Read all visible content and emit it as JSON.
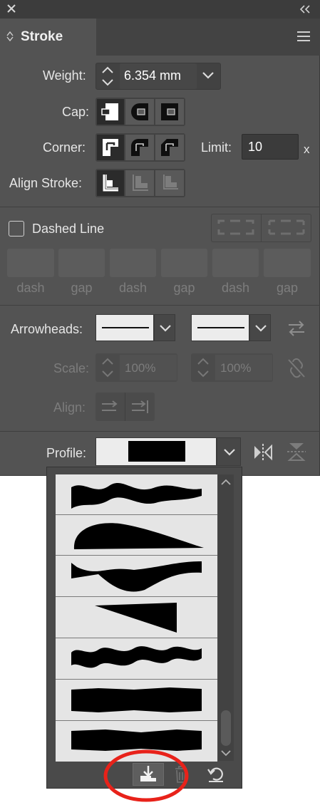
{
  "panel": {
    "title": "Stroke",
    "close_icon": "close-icon",
    "collapse_icon": "collapse-chevrons-icon",
    "menu_icon": "panel-menu-icon"
  },
  "weight": {
    "label": "Weight:",
    "value": "6.354 mm"
  },
  "cap": {
    "label": "Cap:",
    "options": [
      "butt-cap-icon",
      "round-cap-icon",
      "projecting-cap-icon"
    ],
    "selected": 0
  },
  "corner": {
    "label": "Corner:",
    "options": [
      "miter-join-icon",
      "round-join-icon",
      "bevel-join-icon"
    ],
    "selected": 0,
    "limit_label": "Limit:",
    "limit_value": "10",
    "limit_unit": "x"
  },
  "align_stroke": {
    "label": "Align Stroke:",
    "options": [
      "align-center-icon",
      "align-inside-icon",
      "align-outside-icon"
    ],
    "selected": 0
  },
  "dashed": {
    "label": "Dashed Line",
    "checked": false,
    "fields": [
      {
        "label": "dash",
        "value": ""
      },
      {
        "label": "gap",
        "value": ""
      },
      {
        "label": "dash",
        "value": ""
      },
      {
        "label": "gap",
        "value": ""
      },
      {
        "label": "dash",
        "value": ""
      },
      {
        "label": "gap",
        "value": ""
      }
    ]
  },
  "arrowheads": {
    "label": "Arrowheads:",
    "start": "none",
    "end": "none"
  },
  "scale": {
    "label": "Scale:",
    "start": "100%",
    "end": "100%"
  },
  "align": {
    "label": "Align:"
  },
  "profile": {
    "label": "Profile:",
    "selected": "uniform"
  },
  "profile_list": {
    "items": [
      "width-profile-wavy",
      "width-profile-leaf",
      "width-profile-bulge",
      "width-profile-triangle",
      "width-profile-wave",
      "width-profile-rough-1",
      "width-profile-rough-2"
    ],
    "footer": [
      "add-to-profiles-icon",
      "delete-profile-icon",
      "reset-profiles-icon"
    ]
  },
  "colors": {
    "panel_bg": "#535353",
    "highlight_circle": "#e8221a"
  }
}
